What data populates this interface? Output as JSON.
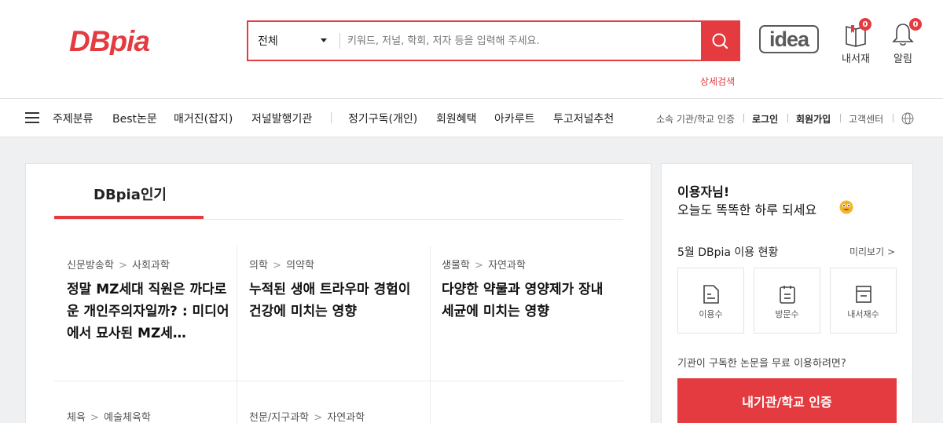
{
  "header": {
    "logo_text": "DBpia",
    "search": {
      "category": "전체",
      "placeholder": "키워드, 저널, 학회, 저자 등을 입력해 주세요."
    },
    "detail_search": "상세검색",
    "idea_logo": "idea",
    "library": {
      "label": "내서재",
      "badge": "0",
      "icon": "book-icon"
    },
    "alarm": {
      "label": "알림",
      "badge": "0",
      "icon": "bell-icon"
    }
  },
  "nav": {
    "items": [
      "주제분류",
      "Best논문",
      "매거진(잡지)",
      "저널발행기관",
      "정기구독(개인)",
      "회원혜택",
      "아카루트",
      "투고저널추천"
    ],
    "util": [
      "소속 기관/학교 인증",
      "로그인",
      "회원가입",
      "고객센터"
    ]
  },
  "main": {
    "tab_title": "DBpia인기",
    "articles": [
      {
        "cat1": "신문방송학",
        "cat2": "사회과학",
        "title": "정말 MZ세대 직원은 까다로운 개인주의자일까? : 미디어에서 묘사된 MZ세…"
      },
      {
        "cat1": "의학",
        "cat2": "의약학",
        "title": "누적된 생애 트라우마 경험이 건강에 미치는 영향"
      },
      {
        "cat1": "생물학",
        "cat2": "자연과학",
        "title": "다양한 약물과 영양제가 장내세균에 미치는 영향"
      },
      {
        "cat1": "체육",
        "cat2": "예술체육학",
        "title": ""
      },
      {
        "cat1": "천문/지구과학",
        "cat2": "자연과학",
        "title": ""
      }
    ]
  },
  "side": {
    "greeting_name": "이용자님!",
    "greeting_msg": "오늘도 똑똑한 하루 되세요",
    "usage_title": "5월 DBpia 이용 현황",
    "preview": "미리보기 >",
    "stats": [
      "이용수",
      "방문수",
      "내서재수"
    ],
    "institution_question": "기관이 구독한 논문을 무료 이용하려면?",
    "cert_button": "내기관/학교 인증"
  },
  "colors": {
    "accent": "#e33b3f",
    "background": "#eef0f2"
  }
}
